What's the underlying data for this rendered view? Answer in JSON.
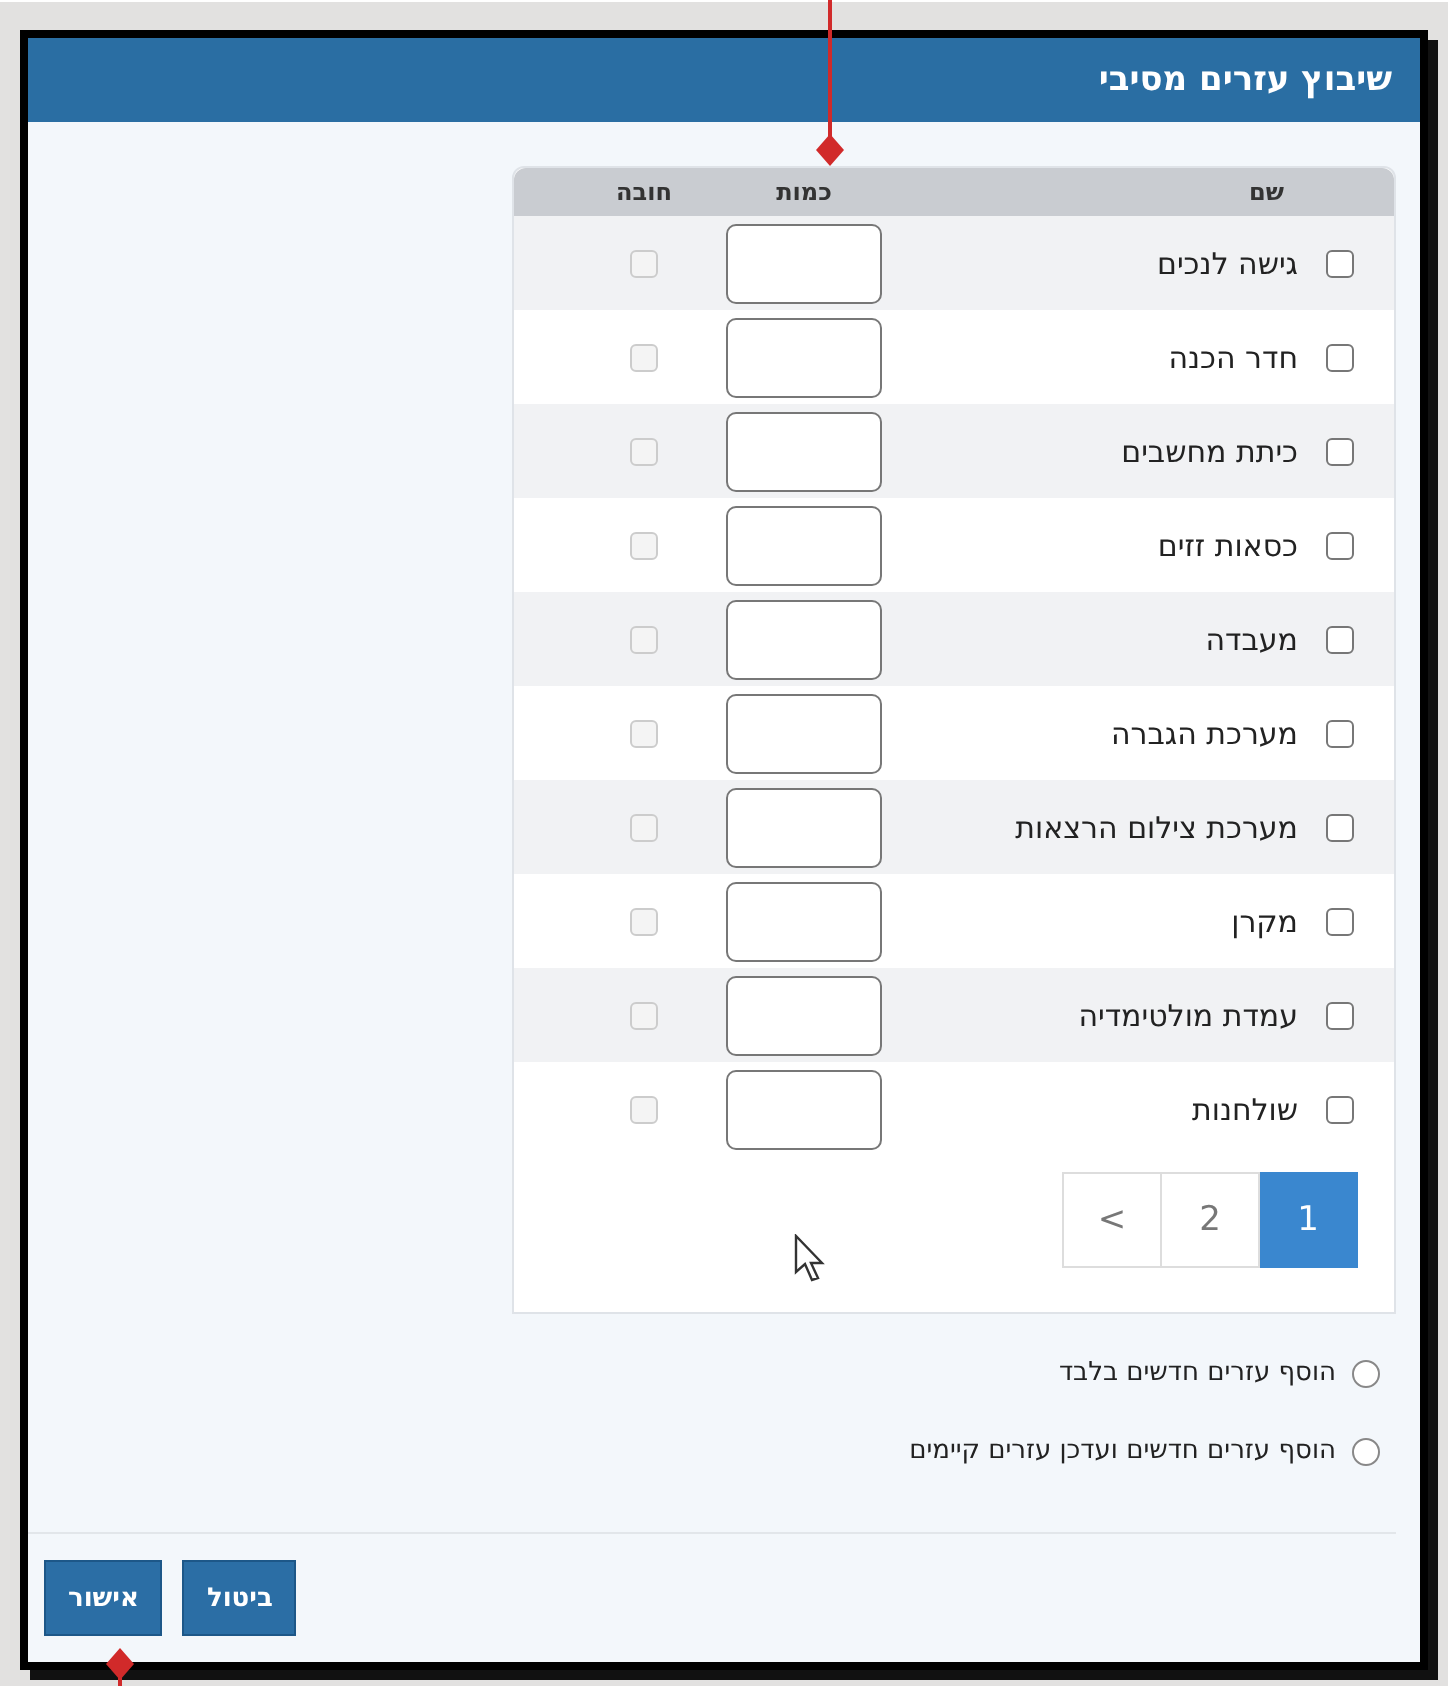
{
  "dialog": {
    "title": "שיבוץ עזרים מסיבי"
  },
  "table": {
    "columns": [
      "שם",
      "כמות",
      "חובה"
    ],
    "rows": [
      {
        "name": "גישה לנכים",
        "checked": false,
        "required": false
      },
      {
        "name": "חדר הכנה",
        "checked": false,
        "required": false
      },
      {
        "name": "כיתת מחשבים",
        "checked": false,
        "required": false
      },
      {
        "name": "כסאות זזים",
        "checked": false,
        "required": false
      },
      {
        "name": "מעבדה",
        "checked": false,
        "required": false
      },
      {
        "name": "מערכת הגברה",
        "checked": false,
        "required": false
      },
      {
        "name": "מערכת צילום הרצאות",
        "checked": false,
        "required": false
      },
      {
        "name": "מקרן",
        "checked": false,
        "required": false
      },
      {
        "name": "עמדת מולטימדיה",
        "checked": false,
        "required": false
      },
      {
        "name": "שולחנות",
        "checked": false,
        "required": false
      }
    ]
  },
  "pagination": [
    {
      "label": "1",
      "selected": true
    },
    {
      "label": "2",
      "selected": false
    },
    {
      "label": "<",
      "selected": false
    }
  ],
  "options": [
    {
      "label": "הוסף עזרים חדשים בלבד",
      "selected": false
    },
    {
      "label": "הוסף עזרים חדשים ועדכן עזרים קיימים",
      "selected": false
    }
  ],
  "buttons": [
    {
      "label": "ביטול"
    },
    {
      "label": "אישור"
    }
  ]
}
